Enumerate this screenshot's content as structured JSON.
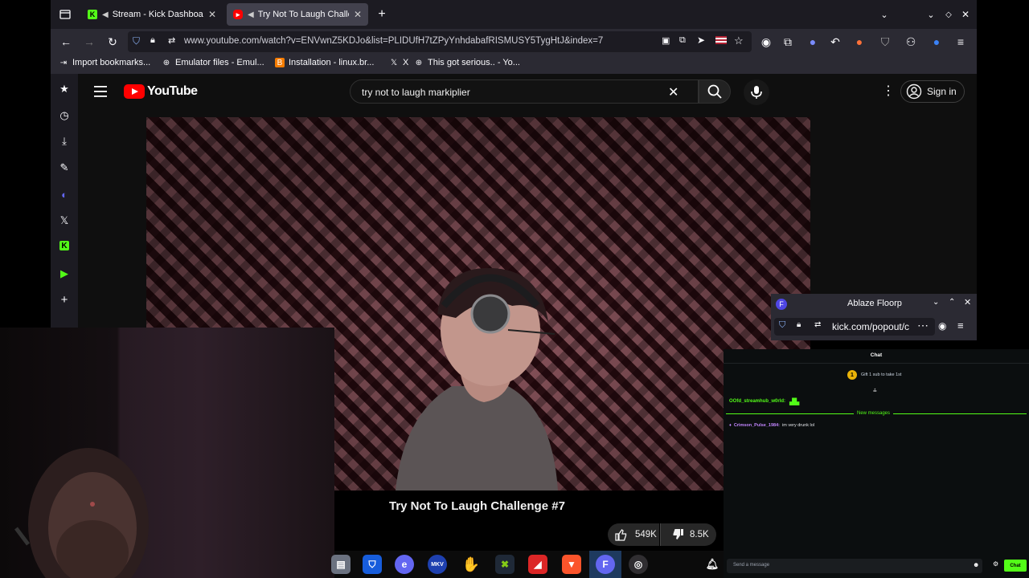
{
  "browser": {
    "tabs": [
      {
        "label": "Stream - Kick Dashboard",
        "icon": "kick-icon",
        "active": false
      },
      {
        "label": "Try Not To Laugh Challe",
        "icon": "youtube-icon",
        "active": true
      }
    ],
    "url": "www.youtube.com/watch?v=ENVwnZ5KDJo&list=PLIDUfH7tZPyYnhdabafRISMUSY5TygHtJ&index=7",
    "bookmarks": [
      {
        "label": "Import bookmarks...",
        "icon": "import-icon"
      },
      {
        "label": "Emulator files - Emul...",
        "icon": "globe-icon"
      },
      {
        "label": "Installation - linux.br...",
        "icon": "blogger-icon"
      },
      {
        "label": "X",
        "icon": "x-icon"
      },
      {
        "label": "This got serious.. - Yo...",
        "icon": "globe-icon"
      }
    ],
    "sidebar_icons": [
      "bookmark-star-icon",
      "history-icon",
      "download-icon",
      "notes-icon",
      "floorp-icon",
      "x-icon",
      "kick-icon",
      "play-icon",
      "add-icon"
    ]
  },
  "youtube": {
    "logo_text": "YouTube",
    "search_value": "try not to laugh markiplier",
    "signin_label": "Sign in",
    "video_title": "Try Not To Laugh Challenge #7",
    "likes": "549K",
    "dislikes": "8.5K"
  },
  "popup": {
    "title": "Ablaze Floorp",
    "url": "kick.com/popout/c"
  },
  "chat": {
    "header": "Chat",
    "gift_text": "Gift 1 sub to take 1st",
    "messages": [
      {
        "user": "OOfd_streamhub_w0rld:",
        "text": "",
        "color": "#53fc18"
      },
      {
        "user": "Crimson_Pulse_1984:",
        "text": "im very drunk lol",
        "color": "#c084fc"
      }
    ],
    "new_messages_label": "New messages",
    "input_placeholder": "Send a message",
    "send_label": "Chat"
  },
  "taskbar": {
    "icons": [
      "files-icon",
      "bitwarden-icon",
      "floorp-icon",
      "mkv-icon",
      "wave-hand-icon",
      "xemu-icon",
      "app-icon",
      "brave-icon",
      "floorp-active-icon",
      "obs-icon"
    ]
  },
  "colors": {
    "youtube_red": "#ff0000",
    "kick_green": "#53fc18",
    "floorp_blue": "#4f46e5"
  }
}
